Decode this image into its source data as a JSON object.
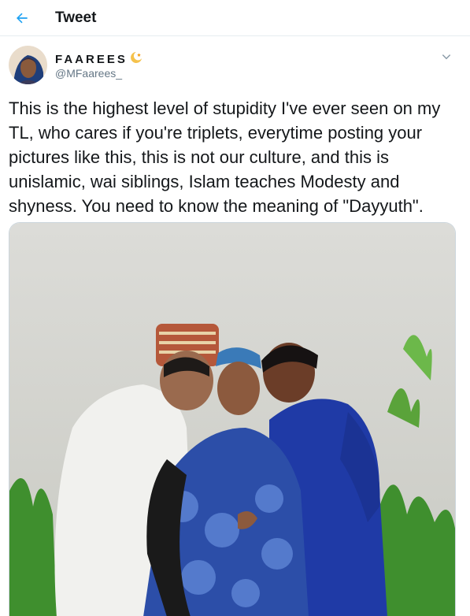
{
  "header": {
    "title": "Tweet",
    "back_icon": "back-arrow-icon",
    "accent_color": "#1da1f2"
  },
  "tweet": {
    "author": {
      "display_name": "FAAREES",
      "handle": "@MFaarees_",
      "badge_icon": "moon-star-emoji-icon"
    },
    "menu_icon": "chevron-down-icon",
    "text": "This is the highest level of stupidity I've ever seen on my TL, who cares if you're triplets, everytime posting your pictures like this, this is not our culture, and this is unislamic, wai siblings, Islam teaches Modesty and shyness. You need to know the meaning of \"Dayyuth\".",
    "media": {
      "type": "photo"
    }
  }
}
